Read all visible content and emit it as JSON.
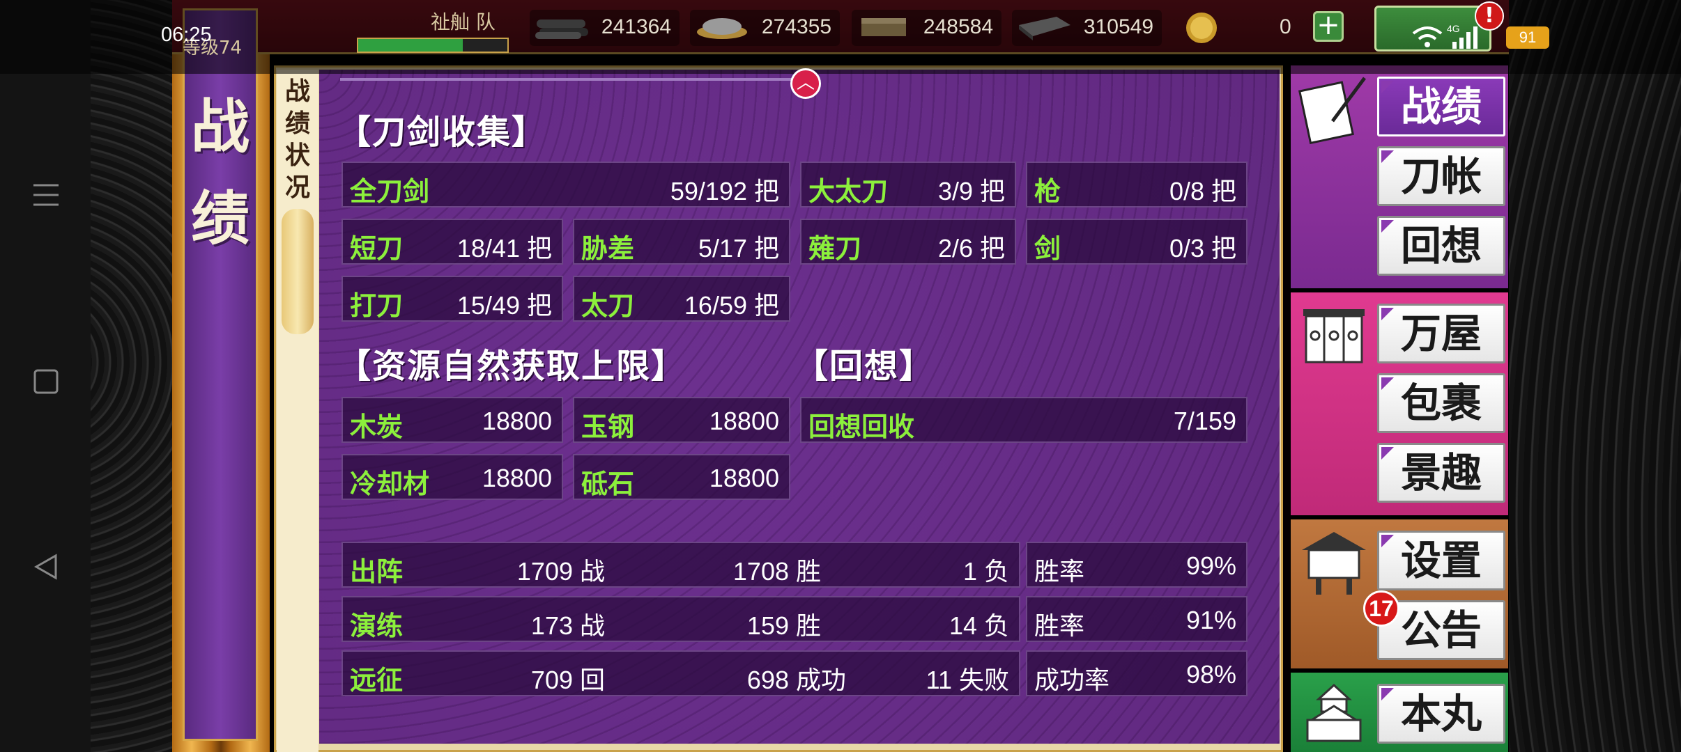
{
  "status_bar": {
    "time": "06:25",
    "battery": "91",
    "network": "4G"
  },
  "top_bar": {
    "team": "祉舢 队",
    "level_label": "等级74",
    "level_progress": 0.7,
    "resources": [
      "241364",
      "274355",
      "248584",
      "310549"
    ],
    "coin": "0"
  },
  "side_banner": {
    "char1": "战",
    "char2": "绩"
  },
  "vertical_tab": "战绩状况",
  "sections": {
    "sword_title": "【刀剑收集】",
    "resource_title": "【资源自然获取上限】",
    "recall_title": "【回想】"
  },
  "swords": {
    "all": {
      "label": "全刀剑",
      "value": "59/192 把"
    },
    "odachi": {
      "label": "大太刀",
      "value": "3/9 把"
    },
    "yari": {
      "label": "枪",
      "value": "0/8 把"
    },
    "tanto": {
      "label": "短刀",
      "value": "18/41 把"
    },
    "wakizashi": {
      "label": "胁差",
      "value": "5/17 把"
    },
    "naginata": {
      "label": "薙刀",
      "value": "2/6 把"
    },
    "tsurugi": {
      "label": "剑",
      "value": "0/3 把"
    },
    "uchigatana": {
      "label": "打刀",
      "value": "15/49 把"
    },
    "tachi": {
      "label": "太刀",
      "value": "16/59 把"
    }
  },
  "resources_limit": {
    "charcoal": {
      "label": "木炭",
      "value": "18800"
    },
    "steel": {
      "label": "玉钢",
      "value": "18800"
    },
    "coolant": {
      "label": "冷却材",
      "value": "18800"
    },
    "whetstone": {
      "label": "砥石",
      "value": "18800"
    }
  },
  "recall": {
    "label": "回想回收",
    "value": "7/159"
  },
  "records": [
    {
      "label": "出阵",
      "a": "1709 战",
      "b": "1708 胜",
      "c": "1 负",
      "rate_label": "胜率",
      "rate": "99%"
    },
    {
      "label": "演练",
      "a": "173 战",
      "b": "159 胜",
      "c": "14 负",
      "rate_label": "胜率",
      "rate": "91%"
    },
    {
      "label": "远征",
      "a": "709 回",
      "b": "698 成功",
      "c": "11 失败",
      "rate_label": "成功率",
      "rate": "98%"
    }
  ],
  "menu": {
    "record": "战绩",
    "sword_book": "刀帐",
    "recollection": "回想",
    "shop": "万屋",
    "inventory": "包裹",
    "scenery": "景趣",
    "settings": "设置",
    "notice": "公告",
    "home": "本丸",
    "notice_badge": "17"
  }
}
